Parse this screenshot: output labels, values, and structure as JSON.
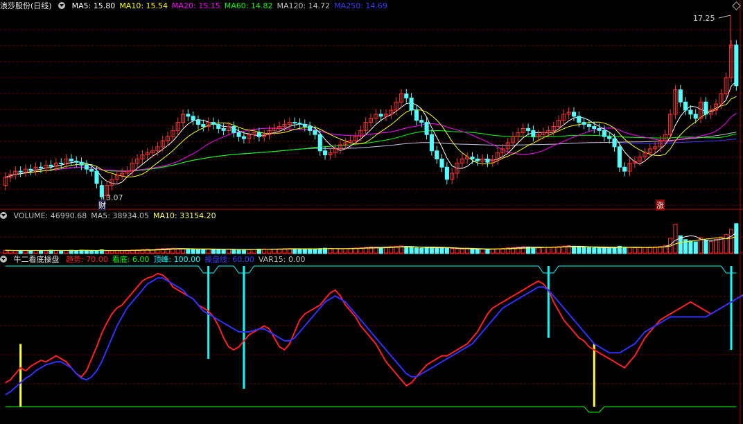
{
  "main_panel": {
    "title": "浪莎股份(日线)",
    "ma_labels": [
      {
        "text": "MA5: 15.80",
        "color": "#ffffff"
      },
      {
        "text": "MA10: 15.54",
        "color": "#ffff00"
      },
      {
        "text": "MA20: 15.15",
        "color": "#ff00ff"
      },
      {
        "text": "MA60: 14.82",
        "color": "#00ff00"
      },
      {
        "text": "MA120: 14.72",
        "color": "#c0c0c0"
      },
      {
        "text": "MA250: 14.69",
        "color": "#3b3bff"
      }
    ],
    "high_marker": "17.25",
    "low_marker": "13.07",
    "tag_cai": "财",
    "tag_zhang": "涨"
  },
  "volume_panel": {
    "labels": [
      {
        "text": "VOLUME: 46990.68",
        "color": "#c0c0c0"
      },
      {
        "text": "MA5: 38934.05",
        "color": "#c0c0c0"
      },
      {
        "text": "MA10: 33154.20",
        "color": "#ffff66"
      }
    ]
  },
  "indicator_panel": {
    "title": "牛二看底操盘",
    "labels": [
      {
        "text": "趋势: 70.00",
        "color": "#ff2020"
      },
      {
        "text": "看底: 6.00",
        "color": "#00ff00"
      },
      {
        "text": "顶峰: 100.00",
        "color": "#00ffff"
      },
      {
        "text": "操盘线: 60.00",
        "color": "#3b3bff"
      },
      {
        "text": "VAR15: 0.00",
        "color": "#c0c0c0"
      }
    ]
  },
  "colors": {
    "up": "#ff3232",
    "down": "#54fcfc",
    "ma5": "#ffffff",
    "ma10": "#ffff00",
    "ma20": "#ff00ff",
    "ma60": "#00ff00",
    "ma120": "#c0c0c0",
    "ma250": "#3b3bff",
    "grid": "#8b0000",
    "separator": "#b00000"
  },
  "chart_data": [
    {
      "type": "candlestick",
      "ylim": [
        12.8,
        17.6
      ],
      "grid": true,
      "close": [
        13.55,
        13.62,
        13.7,
        13.68,
        13.75,
        13.72,
        13.8,
        13.78,
        13.85,
        13.82,
        13.9,
        13.88,
        14.0,
        13.95,
        13.92,
        13.85,
        13.75,
        13.7,
        13.4,
        13.07,
        13.35,
        13.5,
        13.6,
        13.65,
        13.7,
        13.9,
        14.0,
        14.1,
        14.15,
        14.2,
        14.3,
        14.45,
        14.55,
        14.7,
        14.9,
        15.1,
        15.05,
        14.95,
        14.85,
        14.8,
        14.9,
        14.85,
        14.75,
        14.7,
        14.8,
        14.65,
        14.55,
        14.5,
        14.6,
        14.65,
        14.55,
        14.6,
        14.7,
        14.75,
        14.8,
        14.85,
        14.9,
        14.88,
        14.85,
        14.8,
        14.7,
        14.6,
        14.2,
        14.1,
        14.15,
        14.25,
        14.35,
        14.4,
        14.45,
        14.55,
        14.7,
        14.9,
        15.0,
        15.1,
        15.05,
        15.1,
        15.2,
        15.4,
        15.6,
        15.5,
        15.2,
        14.95,
        14.9,
        14.6,
        14.2,
        14.0,
        13.8,
        13.5,
        13.65,
        13.9,
        14.0,
        14.05,
        14.0,
        13.95,
        14.0,
        13.92,
        13.98,
        14.15,
        14.25,
        14.4,
        14.55,
        14.65,
        14.75,
        14.7,
        14.55,
        14.6,
        14.65,
        14.7,
        14.8,
        14.95,
        15.1,
        15.15,
        15.05,
        14.9,
        14.85,
        14.8,
        14.75,
        14.7,
        14.55,
        14.5,
        14.3,
        13.8,
        13.7,
        13.9,
        13.95,
        14.05,
        14.15,
        14.25,
        14.3,
        14.45,
        14.6,
        15.1,
        15.7,
        15.4,
        15.2,
        15.1,
        15.0,
        15.4,
        15.1,
        15.2,
        15.35,
        15.6,
        16.0,
        16.8,
        15.8
      ],
      "open": [
        13.35,
        13.55,
        13.62,
        13.7,
        13.68,
        13.75,
        13.72,
        13.8,
        13.78,
        13.85,
        13.82,
        13.9,
        13.88,
        14.0,
        13.95,
        13.92,
        13.85,
        13.75,
        13.7,
        13.35,
        13.1,
        13.35,
        13.5,
        13.6,
        13.65,
        13.7,
        13.9,
        14.0,
        14.1,
        14.15,
        14.2,
        14.3,
        14.45,
        14.55,
        14.7,
        14.9,
        15.1,
        15.05,
        14.95,
        14.85,
        14.8,
        14.9,
        14.85,
        14.75,
        14.7,
        14.8,
        14.65,
        14.55,
        14.5,
        14.6,
        14.65,
        14.55,
        14.6,
        14.7,
        14.75,
        14.8,
        14.85,
        14.9,
        14.88,
        14.85,
        14.8,
        14.7,
        14.6,
        14.2,
        14.1,
        14.15,
        14.25,
        14.35,
        14.4,
        14.45,
        14.55,
        14.7,
        14.9,
        15.0,
        15.1,
        15.05,
        15.1,
        15.2,
        15.4,
        15.6,
        15.5,
        15.2,
        14.95,
        14.9,
        14.6,
        14.2,
        14.0,
        13.8,
        13.5,
        13.65,
        13.9,
        14.0,
        14.05,
        14.0,
        13.95,
        14.0,
        13.92,
        13.98,
        14.15,
        14.25,
        14.4,
        14.55,
        14.65,
        14.75,
        14.7,
        14.55,
        14.6,
        14.65,
        14.7,
        14.8,
        14.95,
        15.1,
        15.15,
        15.05,
        14.9,
        14.85,
        14.8,
        14.75,
        14.7,
        14.55,
        14.5,
        14.3,
        13.8,
        13.7,
        13.9,
        13.95,
        14.05,
        14.15,
        14.25,
        14.3,
        14.45,
        14.6,
        15.1,
        15.7,
        15.4,
        15.2,
        15.1,
        15.0,
        15.4,
        15.1,
        15.2,
        15.35,
        15.6,
        16.0,
        16.8
      ]
    },
    {
      "type": "bar",
      "name_series": "VOLUME",
      "ylim": [
        0,
        50000
      ],
      "values": [
        5200,
        4800,
        4600,
        5000,
        4700,
        4900,
        5100,
        4800,
        4500,
        5300,
        5000,
        4600,
        4900,
        5200,
        4700,
        5500,
        5000,
        4800,
        4400,
        6000,
        4200,
        4500,
        4700,
        4900,
        5200,
        5600,
        5800,
        6200,
        6500,
        6000,
        7200,
        7800,
        8200,
        8500,
        7600,
        7000,
        7400,
        6800,
        6500,
        6200,
        6900,
        7100,
        6600,
        6300,
        6800,
        6400,
        6000,
        6200,
        5900,
        6500,
        7000,
        7200,
        6800,
        7100,
        7400,
        7800,
        8000,
        7600,
        7300,
        7000,
        7500,
        7200,
        7900,
        8500,
        8200,
        7800,
        7300,
        7900,
        8300,
        8800,
        9200,
        9800,
        10400,
        10100,
        9600,
        9900,
        10800,
        11500,
        12000,
        11200,
        9800,
        9000,
        8600,
        9400,
        10200,
        9100,
        8200,
        8800,
        7600,
        7300,
        7100,
        7500,
        6900,
        6600,
        7000,
        6700,
        7200,
        7800,
        8300,
        9000,
        9600,
        10200,
        10800,
        10300,
        9500,
        9100,
        9500,
        9900,
        10400,
        11000,
        11800,
        12400,
        11600,
        10600,
        9900,
        9500,
        9100,
        8800,
        9300,
        8700,
        9800,
        11500,
        10200,
        9400,
        9000,
        9300,
        9700,
        10000,
        10400,
        11200,
        12800,
        24000,
        46000,
        28000,
        22000,
        20000,
        18500,
        25000,
        21000,
        19000,
        22500,
        26000,
        30000,
        38000,
        46990
      ]
    },
    {
      "type": "line",
      "ylim": [
        0,
        100
      ],
      "series": [
        {
          "name": "趋势",
          "values": [
            22,
            24,
            28,
            32,
            30,
            33,
            35,
            37,
            36,
            38,
            40,
            38,
            36,
            32,
            28,
            26,
            30,
            38,
            46,
            55,
            62,
            68,
            72,
            74,
            78,
            82,
            86,
            90,
            92,
            93,
            95,
            94,
            91,
            86,
            84,
            82,
            80,
            78,
            74,
            72,
            70,
            66,
            60,
            52,
            46,
            44,
            46,
            50,
            54,
            56,
            58,
            60,
            58,
            52,
            46,
            44,
            48,
            56,
            64,
            68,
            70,
            72,
            74,
            78,
            82,
            84,
            80,
            74,
            70,
            66,
            60,
            56,
            52,
            48,
            42,
            36,
            32,
            28,
            24,
            20,
            22,
            26,
            30,
            34,
            36,
            38,
            40,
            40,
            42,
            44,
            46,
            48,
            52,
            56,
            62,
            68,
            72,
            74,
            76,
            78,
            80,
            82,
            84,
            86,
            88,
            90,
            88,
            84,
            76,
            70,
            64,
            60,
            56,
            52,
            50,
            46,
            44,
            42,
            40,
            38,
            36,
            34,
            32,
            36,
            40,
            46,
            52,
            56,
            60,
            64,
            66,
            68,
            70,
            72,
            74,
            76,
            74,
            72,
            70,
            68,
            70,
            72,
            74,
            76,
            78,
            80,
            82,
            84,
            72
          ]
        },
        {
          "name": "操盘线",
          "values": [
            14,
            16,
            19,
            22,
            25,
            27,
            30,
            32,
            34,
            35,
            36,
            36,
            34,
            32,
            28,
            25,
            24,
            26,
            30,
            36,
            44,
            52,
            60,
            66,
            72,
            76,
            80,
            84,
            88,
            90,
            92,
            92,
            90,
            88,
            86,
            84,
            80,
            78,
            74,
            70,
            68,
            66,
            64,
            62,
            60,
            58,
            56,
            56,
            56,
            57,
            58,
            58,
            56,
            54,
            52,
            50,
            50,
            52,
            56,
            60,
            64,
            68,
            72,
            76,
            78,
            80,
            78,
            76,
            72,
            68,
            64,
            60,
            56,
            52,
            48,
            44,
            40,
            36,
            32,
            28,
            26,
            26,
            28,
            30,
            32,
            34,
            36,
            38,
            40,
            42,
            44,
            46,
            48,
            52,
            56,
            60,
            64,
            68,
            72,
            74,
            76,
            78,
            80,
            82,
            84,
            86,
            86,
            84,
            80,
            76,
            72,
            68,
            64,
            60,
            56,
            52,
            48,
            46,
            44,
            42,
            42,
            42,
            44,
            46,
            48,
            52,
            56,
            58,
            60,
            62,
            64,
            66,
            66,
            66,
            66,
            66,
            66,
            66,
            66,
            68,
            70,
            72,
            74,
            76,
            78,
            80,
            80,
            80,
            78
          ]
        }
      ],
      "cyan_bars_idx": [
        40,
        47,
        107,
        143
      ],
      "yellow_bars_idx": [
        3,
        116,
        148
      ],
      "peak_level": 100,
      "base_level": 6
    }
  ]
}
